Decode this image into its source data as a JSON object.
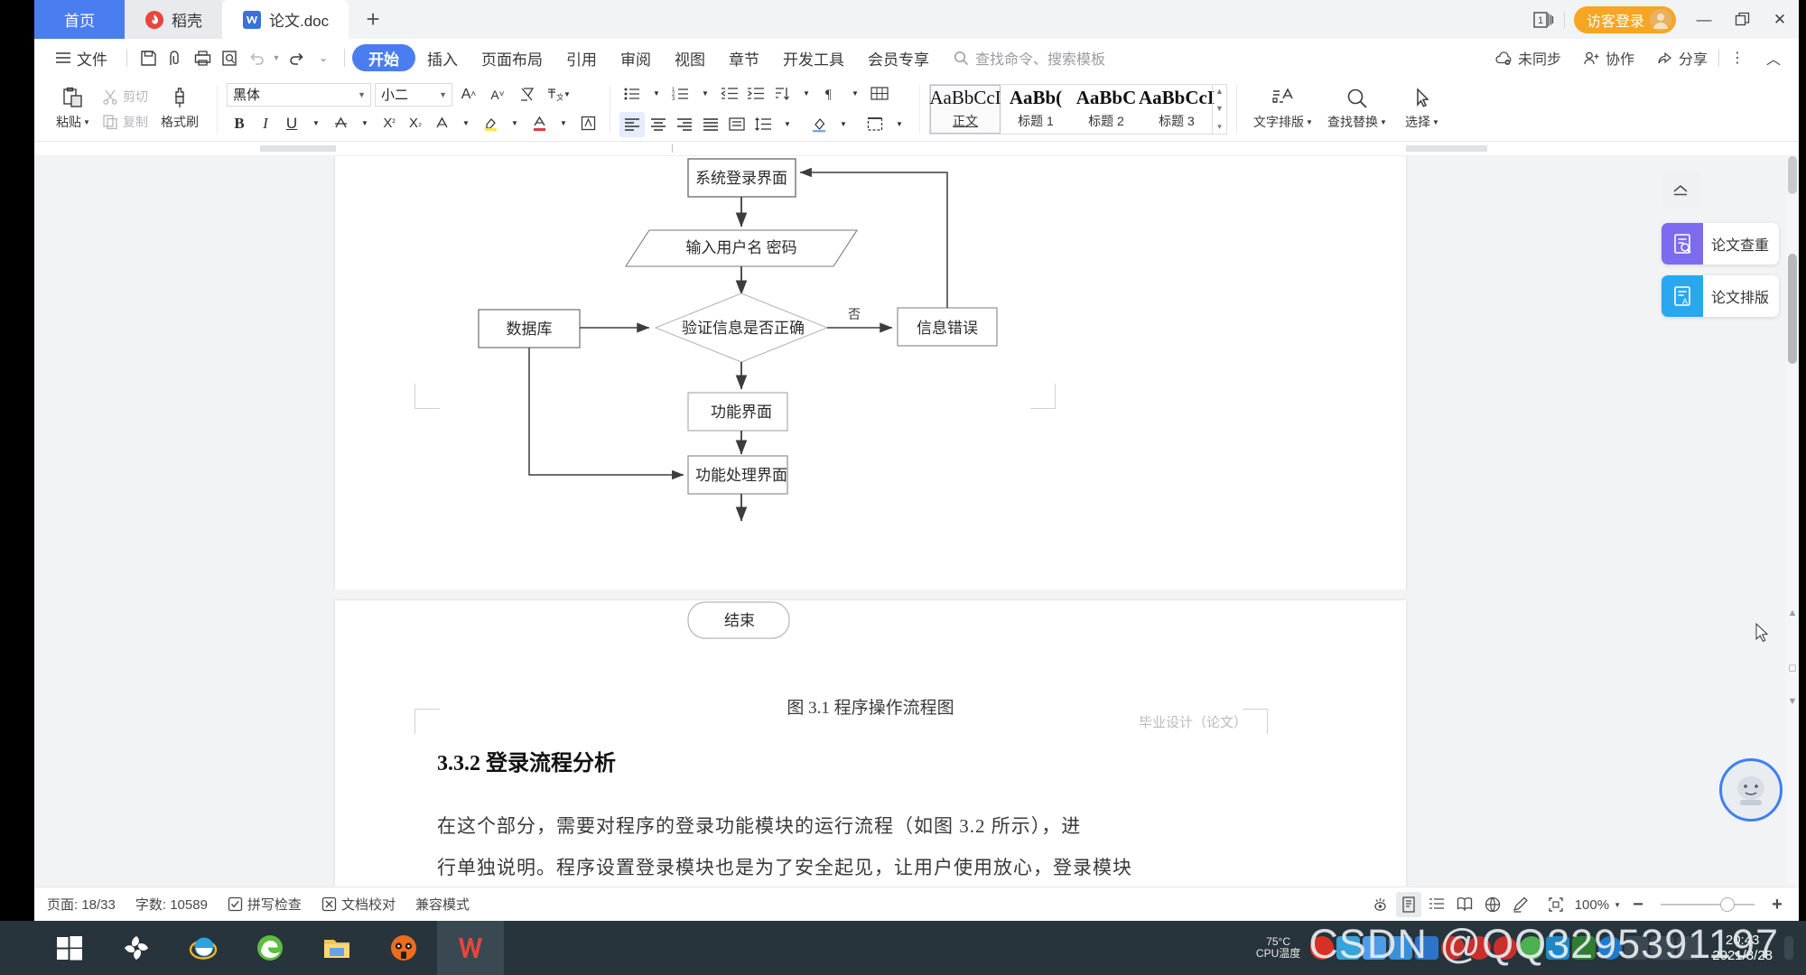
{
  "window": {
    "tabs": [
      {
        "label": "首页",
        "icon": "home-tab"
      },
      {
        "label": "稻壳",
        "icon": "docer-icon"
      },
      {
        "label": "论文.doc",
        "icon": "wps-doc-icon"
      }
    ],
    "new_tab_label": "+",
    "doc_count_badge": "1",
    "guest_login_label": "访客登录",
    "minimize": "—",
    "restore": "❐",
    "close": "✕"
  },
  "menu": {
    "file_label": "文件",
    "quick_access": [
      "save-icon",
      "save-as-icon",
      "print-icon",
      "print-preview-icon",
      "undo-icon",
      "redo-icon",
      "customize-icon"
    ],
    "items": [
      "开始",
      "插入",
      "页面布局",
      "引用",
      "审阅",
      "视图",
      "章节",
      "开发工具",
      "会员专享"
    ],
    "active_item": "开始",
    "search_placeholder": "查找命令、搜索模板",
    "right_items": [
      {
        "label": "未同步",
        "icon": "cloud-sync-icon"
      },
      {
        "label": "协作",
        "icon": "collaborate-icon"
      },
      {
        "label": "分享",
        "icon": "share-icon"
      }
    ],
    "more_label": "⋮",
    "collapse_label": "︿"
  },
  "ribbon": {
    "paste_label": "粘贴",
    "cut_label": "剪切",
    "copy_label": "复制",
    "format_painter_label": "格式刷",
    "font_name": "黑体",
    "font_size": "小二",
    "grow_font": "A⁺",
    "shrink_font": "A⁻",
    "clear_format": "clear-format-icon",
    "pinyin_guide": "wén-icon",
    "bold": "B",
    "italic": "I",
    "underline": "U",
    "strikethrough": "A-strike",
    "superscript": "X²",
    "subscript": "X₂",
    "char_shading": "A-shade",
    "highlight": "highlight-icon",
    "font_color": "A-color",
    "text_box": "A-box",
    "bullets": "bullet-list-icon",
    "numbering": "numbered-list-icon",
    "multilevel": "multilevel-list-icon",
    "decrease_indent": "decrease-indent-icon",
    "increase_indent": "increase-indent-icon",
    "sort": "sort-icon",
    "show_marks": "paragraph-marks-icon",
    "chinese_layout": "chinese-layout-icon",
    "borders_grid": "grid-icon",
    "align_left": "align-left-icon",
    "align_center": "align-center-icon",
    "align_right": "align-right-icon",
    "align_justify": "align-justify-icon",
    "distributed": "distributed-align-icon",
    "line_spacing": "line-spacing-icon",
    "shading": "shading-icon",
    "border": "border-icon",
    "styles": [
      {
        "preview": "AaBbCcI",
        "name": "正文",
        "bold": false,
        "selected": true
      },
      {
        "preview": "AaBb(",
        "name": "标题 1",
        "bold": true,
        "selected": false
      },
      {
        "preview": "AaBbC",
        "name": "标题 2",
        "bold": true,
        "selected": false
      },
      {
        "preview": "AaBbCcI",
        "name": "标题 3",
        "bold": true,
        "selected": false
      }
    ],
    "text_layout_label": "文字排版",
    "find_replace_label": "查找替换",
    "select_label": "选择"
  },
  "document": {
    "flowchart": {
      "title": "程序操作流程图",
      "nodes": [
        {
          "id": "login",
          "text": "系统登录界面",
          "shape": "rect"
        },
        {
          "id": "input",
          "text": "输入用户名 密码",
          "shape": "parallelogram"
        },
        {
          "id": "db",
          "text": "数据库",
          "shape": "rect"
        },
        {
          "id": "verify",
          "text": "验证信息是否正确",
          "shape": "diamond"
        },
        {
          "id": "error",
          "text": "信息错误",
          "shape": "rect"
        },
        {
          "id": "func",
          "text": "功能界面",
          "shape": "rect"
        },
        {
          "id": "process",
          "text": "功能处理界面",
          "shape": "rect"
        },
        {
          "id": "end",
          "text": "结束",
          "shape": "rounded"
        }
      ],
      "edge_labels": [
        {
          "text": "否",
          "from": "verify",
          "to": "error"
        }
      ]
    },
    "figure_caption": "图 3.1  程序操作流程图",
    "heading": "3.3.2  登录流程分析",
    "paragraph_line1": "在这个部分，需要对程序的登录功能模块的运行流程（如图 3.2 所示），进",
    "paragraph_line2": "行单独说明。程序设置登录模块也是为了安全起见，让用户使用放心，登录模块",
    "page_header_faint": "毕业设计（论文）"
  },
  "side_panel": {
    "toggle_icon": "collapse-panel-icon",
    "cards": [
      {
        "label": "论文查重",
        "icon": "paper-check-icon",
        "color": "#7c6af0"
      },
      {
        "label": "论文排版",
        "icon": "paper-format-icon",
        "color": "#2aa8ef"
      }
    ]
  },
  "status_bar": {
    "page_label": "页面: 18/33",
    "word_count_label": "字数: 10589",
    "spell_check_label": "拼写检查",
    "proofread_label": "文档校对",
    "compat_label": "兼容模式",
    "view_icons": [
      "eye-protection-icon",
      "print-layout-icon",
      "outline-view-icon",
      "reading-layout-icon",
      "web-layout-icon",
      "edit-mode-icon",
      "fit-page-icon"
    ],
    "zoom_level": "100%",
    "zoom_out": "−",
    "zoom_in": "+"
  },
  "taskbar": {
    "apps": [
      "start-button",
      "wps-cloud-icon",
      "internet-explorer-icon",
      "edge-icon",
      "file-explorer-icon",
      "maxthon-icon",
      "wps-writer-icon"
    ],
    "cpu_temp_value": "75°C",
    "cpu_temp_label": "CPU温度",
    "clock_time": "20:43",
    "clock_date": "2021/8/28"
  },
  "watermark": "CSDN @QQ3295391197",
  "colors": {
    "accent_blue": "#4a7df0",
    "guest_orange": "#f6a623",
    "taskbar_bg": "#27343c",
    "doc_bg": "#f2f3f5"
  }
}
